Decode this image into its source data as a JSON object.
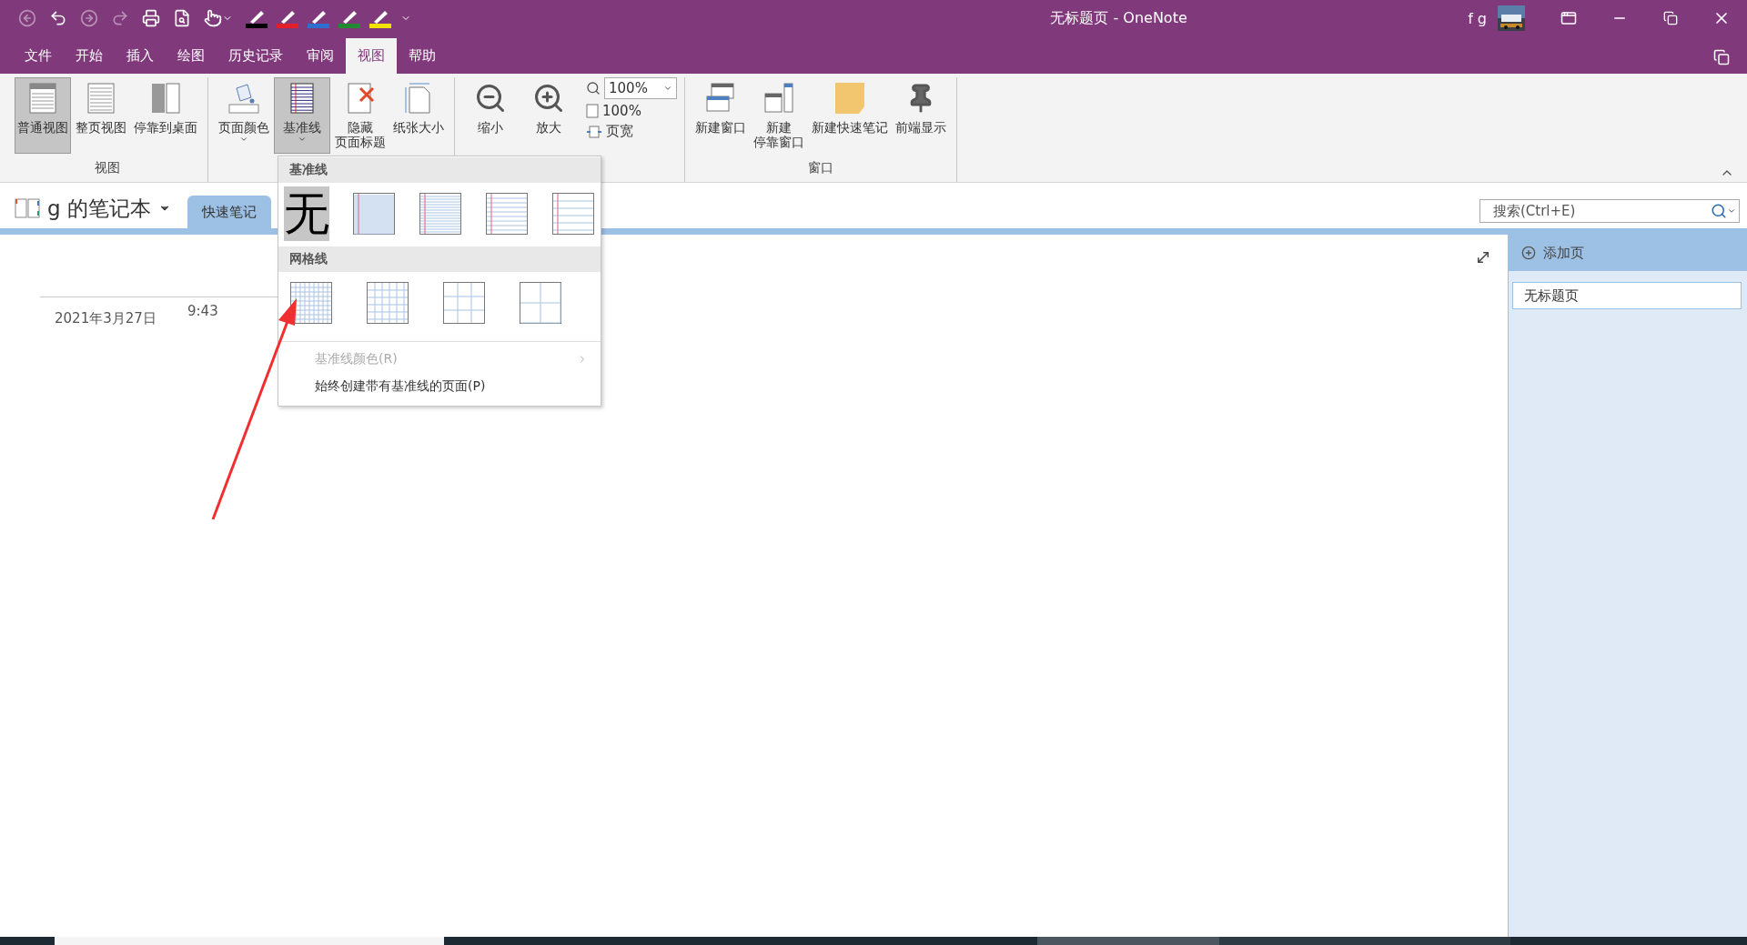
{
  "window": {
    "title": "无标题页 - OneNote",
    "user": "f g"
  },
  "pens": [
    {
      "color": "#000000"
    },
    {
      "color": "#e3202a"
    },
    {
      "color": "#2f6fd0"
    },
    {
      "color": "#1f8a2f"
    },
    {
      "color": "#f2e200"
    }
  ],
  "menu_tabs": [
    {
      "label": "文件",
      "selected": false
    },
    {
      "label": "开始",
      "selected": false
    },
    {
      "label": "插入",
      "selected": false
    },
    {
      "label": "绘图",
      "selected": false
    },
    {
      "label": "历史记录",
      "selected": false
    },
    {
      "label": "审阅",
      "selected": false
    },
    {
      "label": "视图",
      "selected": true
    },
    {
      "label": "帮助",
      "selected": false
    }
  ],
  "ribbon": {
    "groups": [
      {
        "label": "视图",
        "buttons": [
          {
            "kind": "normal-view",
            "lines": [
              "普通视图"
            ],
            "selected": true
          },
          {
            "kind": "full-page",
            "lines": [
              "整页视图"
            ],
            "selected": false
          },
          {
            "kind": "dock",
            "lines": [
              "停靠到桌面"
            ],
            "selected": false
          }
        ]
      },
      {
        "buttons": [
          {
            "kind": "page-color",
            "lines": [
              "页面颜色"
            ],
            "selected": false,
            "dropdown": true
          },
          {
            "kind": "rule-lines",
            "lines": [
              "基准线"
            ],
            "selected": true,
            "dropdown": true
          },
          {
            "kind": "hide-title",
            "lines": [
              "隐藏",
              "页面标题"
            ],
            "selected": false
          },
          {
            "kind": "paper-size",
            "lines": [
              "纸张大小"
            ],
            "selected": false
          }
        ]
      },
      {
        "buttons": [
          {
            "kind": "zoom-out",
            "lines": [
              "缩小"
            ],
            "selected": false
          },
          {
            "kind": "zoom-in",
            "lines": [
              "放大"
            ],
            "selected": false
          }
        ],
        "zoom": {
          "value": "100%",
          "actual": "100%",
          "page_width": "页宽"
        }
      },
      {
        "label": "窗口",
        "buttons": [
          {
            "kind": "new-window",
            "lines": [
              "新建窗口"
            ],
            "selected": false
          },
          {
            "kind": "new-docked",
            "lines": [
              "新建",
              "停靠窗口"
            ],
            "selected": false
          },
          {
            "kind": "quick-note",
            "lines": [
              "新建快速笔记"
            ],
            "selected": false
          },
          {
            "kind": "pin",
            "lines": [
              "前端显示"
            ],
            "selected": false
          }
        ]
      }
    ]
  },
  "notebook": {
    "name": "g 的笔记本",
    "sections": [
      {
        "label": "快速笔记",
        "selected": true
      }
    ]
  },
  "search": {
    "placeholder": "搜索(Ctrl+E)"
  },
  "page": {
    "date": "2021年3月27日",
    "time": "9:43"
  },
  "page_list": {
    "add_label": "添加页",
    "pages": [
      {
        "title": "无标题页",
        "selected": true
      }
    ]
  },
  "rule_menu": {
    "sections": [
      {
        "title": "基准线",
        "options": [
          {
            "kind": "none",
            "label": "无",
            "selected": true
          },
          {
            "kind": "narrow",
            "selected": false
          },
          {
            "kind": "college",
            "selected": false
          },
          {
            "kind": "standard",
            "selected": false
          },
          {
            "kind": "wide",
            "selected": false
          }
        ]
      },
      {
        "title": "网格线",
        "options": [
          {
            "kind": "grid-small",
            "selected": false
          },
          {
            "kind": "grid-medium",
            "selected": false
          },
          {
            "kind": "grid-large",
            "selected": false
          },
          {
            "kind": "grid-xlarge",
            "selected": false
          }
        ]
      }
    ],
    "items": [
      {
        "label": "基准线颜色(R)",
        "disabled": true,
        "submenu": true
      },
      {
        "label": "始终创建带有基准线的页面(P)",
        "disabled": false,
        "submenu": false
      }
    ]
  }
}
